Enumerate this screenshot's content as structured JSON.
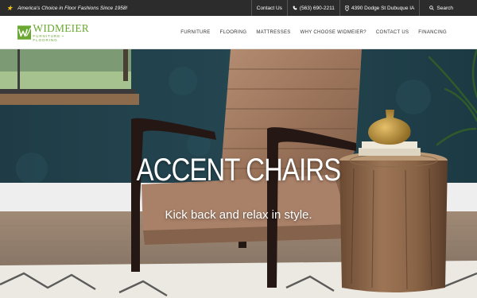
{
  "topbar": {
    "promo": "America's Choice in Floor Fashions Since 1958!",
    "contact": "Contact Us",
    "phone": "(563) 690-2211",
    "address": "4390 Dodge St Dubuque IA",
    "search": "Search"
  },
  "brand": {
    "name": "WIDMEIER",
    "tagline": "FURNITURE • FLOORING",
    "color": "#6aa832"
  },
  "nav": [
    "FURNITURE",
    "FLOORING",
    "MATTRESSES",
    "WHY CHOOSE WIDMEIER?",
    "CONTACT US",
    "FINANCING"
  ],
  "hero": {
    "title": "ACCENT CHAIRS",
    "subtitle": "Kick back and relax in style."
  }
}
